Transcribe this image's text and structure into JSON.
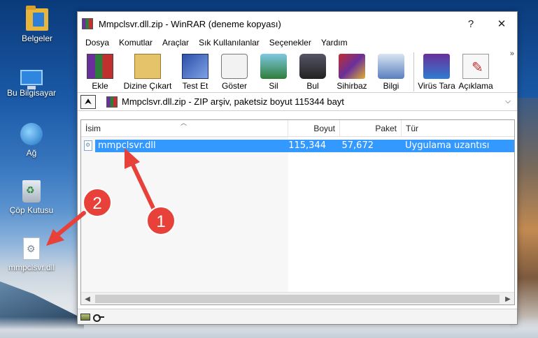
{
  "desktop": {
    "icons": [
      {
        "label": "Belgeler"
      },
      {
        "label": "Bu Bilgisayar"
      },
      {
        "label": "Ağ"
      },
      {
        "label": "Çöp Kutusu"
      },
      {
        "label": "mmpclsvr.dll"
      }
    ]
  },
  "window": {
    "title": "Mmpclsvr.dll.zip - WinRAR (deneme kopyası)",
    "help_btn": "?",
    "close_btn": "✕"
  },
  "menu": {
    "items": [
      "Dosya",
      "Komutlar",
      "Araçlar",
      "Sık Kullanılanlar",
      "Seçenekler",
      "Yardım"
    ]
  },
  "toolbar": {
    "items": [
      "Ekle",
      "Dizine Çıkart",
      "Test Et",
      "Göster",
      "Sil",
      "Bul",
      "Sihirbaz",
      "Bilgi",
      "Virüs Tara",
      "Açıklama"
    ],
    "more": "»"
  },
  "address": {
    "up": "⮝",
    "text": "Mmpclsvr.dll.zip - ZIP arşiv, paketsiz boyut 115344 bayt",
    "dropdown": "⌵"
  },
  "columns": {
    "name": "İsim",
    "size": "Boyut",
    "packed": "Paket",
    "type": "Tür"
  },
  "files": [
    {
      "name": "mmpclsvr.dll",
      "size": "115,344",
      "packed": "57,672",
      "type": "Uygulama uzantısı",
      "selected": true
    }
  ],
  "annotations": [
    {
      "label": "1"
    },
    {
      "label": "2"
    }
  ],
  "colors": {
    "selection": "#3399ff",
    "annotation": "#e8413a"
  }
}
